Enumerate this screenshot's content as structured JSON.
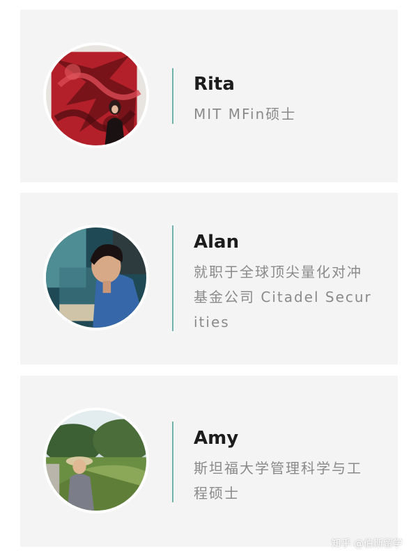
{
  "profiles": [
    {
      "name": "Rita",
      "description": "MIT MFin硕士"
    },
    {
      "name": "Alan",
      "description": "就职于全球顶尖量化对冲基金公司 Citadel Securities"
    },
    {
      "name": "Amy",
      "description": "斯坦福大学管理科学与工程硕士"
    }
  ],
  "watermark": "知乎 @伯斯留学",
  "colors": {
    "card_background": "#f4f4f4",
    "divider": "#6fb3ad",
    "name_text": "#1c1c1c",
    "description_text": "#8a8a8a"
  }
}
